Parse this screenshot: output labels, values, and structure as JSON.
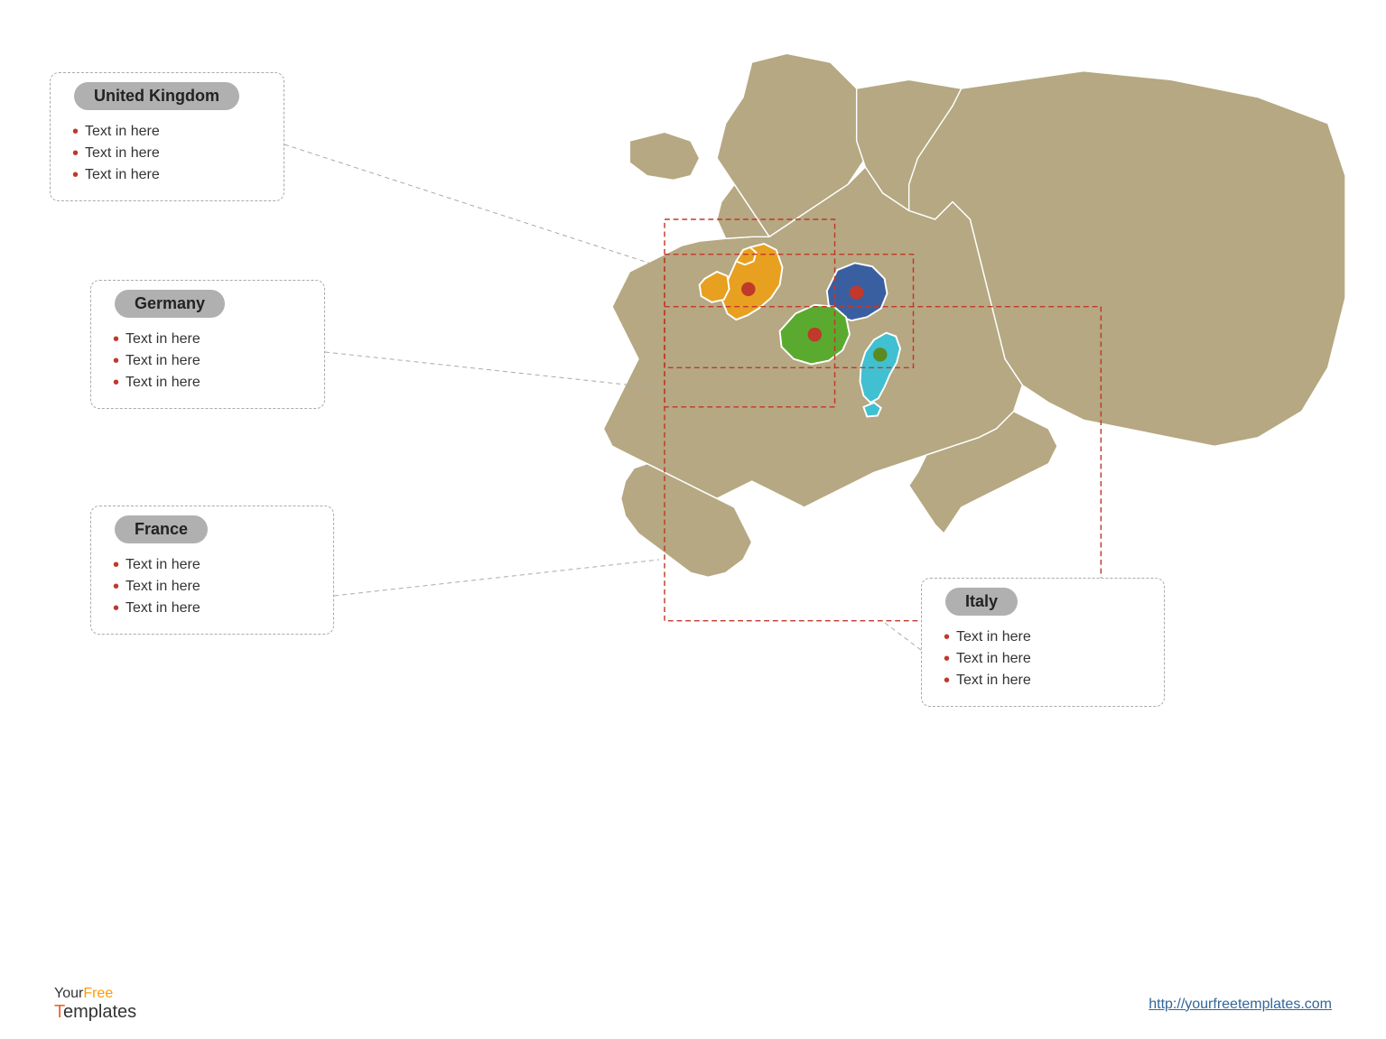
{
  "boxes": {
    "uk": {
      "title": "United Kingdom",
      "items": [
        "Text in here",
        "Text in here",
        "Text in here"
      ]
    },
    "germany": {
      "title": "Germany",
      "items": [
        "Text in here",
        "Text in here",
        "Text in here"
      ]
    },
    "france": {
      "title": "France",
      "items": [
        "Text in here",
        "Text in here",
        "Text in here"
      ]
    },
    "italy": {
      "title": "Italy",
      "items": [
        "Text in here",
        "Text in here",
        "Text in here"
      ]
    }
  },
  "footer": {
    "logo_your": "Your",
    "logo_free": "Free",
    "logo_templates": "Templates",
    "url": "http://yourfreetemplates.com"
  },
  "colors": {
    "land": "#b5a882",
    "uk_fill": "#e8a020",
    "germany_fill": "#3a5fa0",
    "france_fill": "#5aaa30",
    "italy_fill": "#40c0d0",
    "dot": "#c0392b"
  }
}
